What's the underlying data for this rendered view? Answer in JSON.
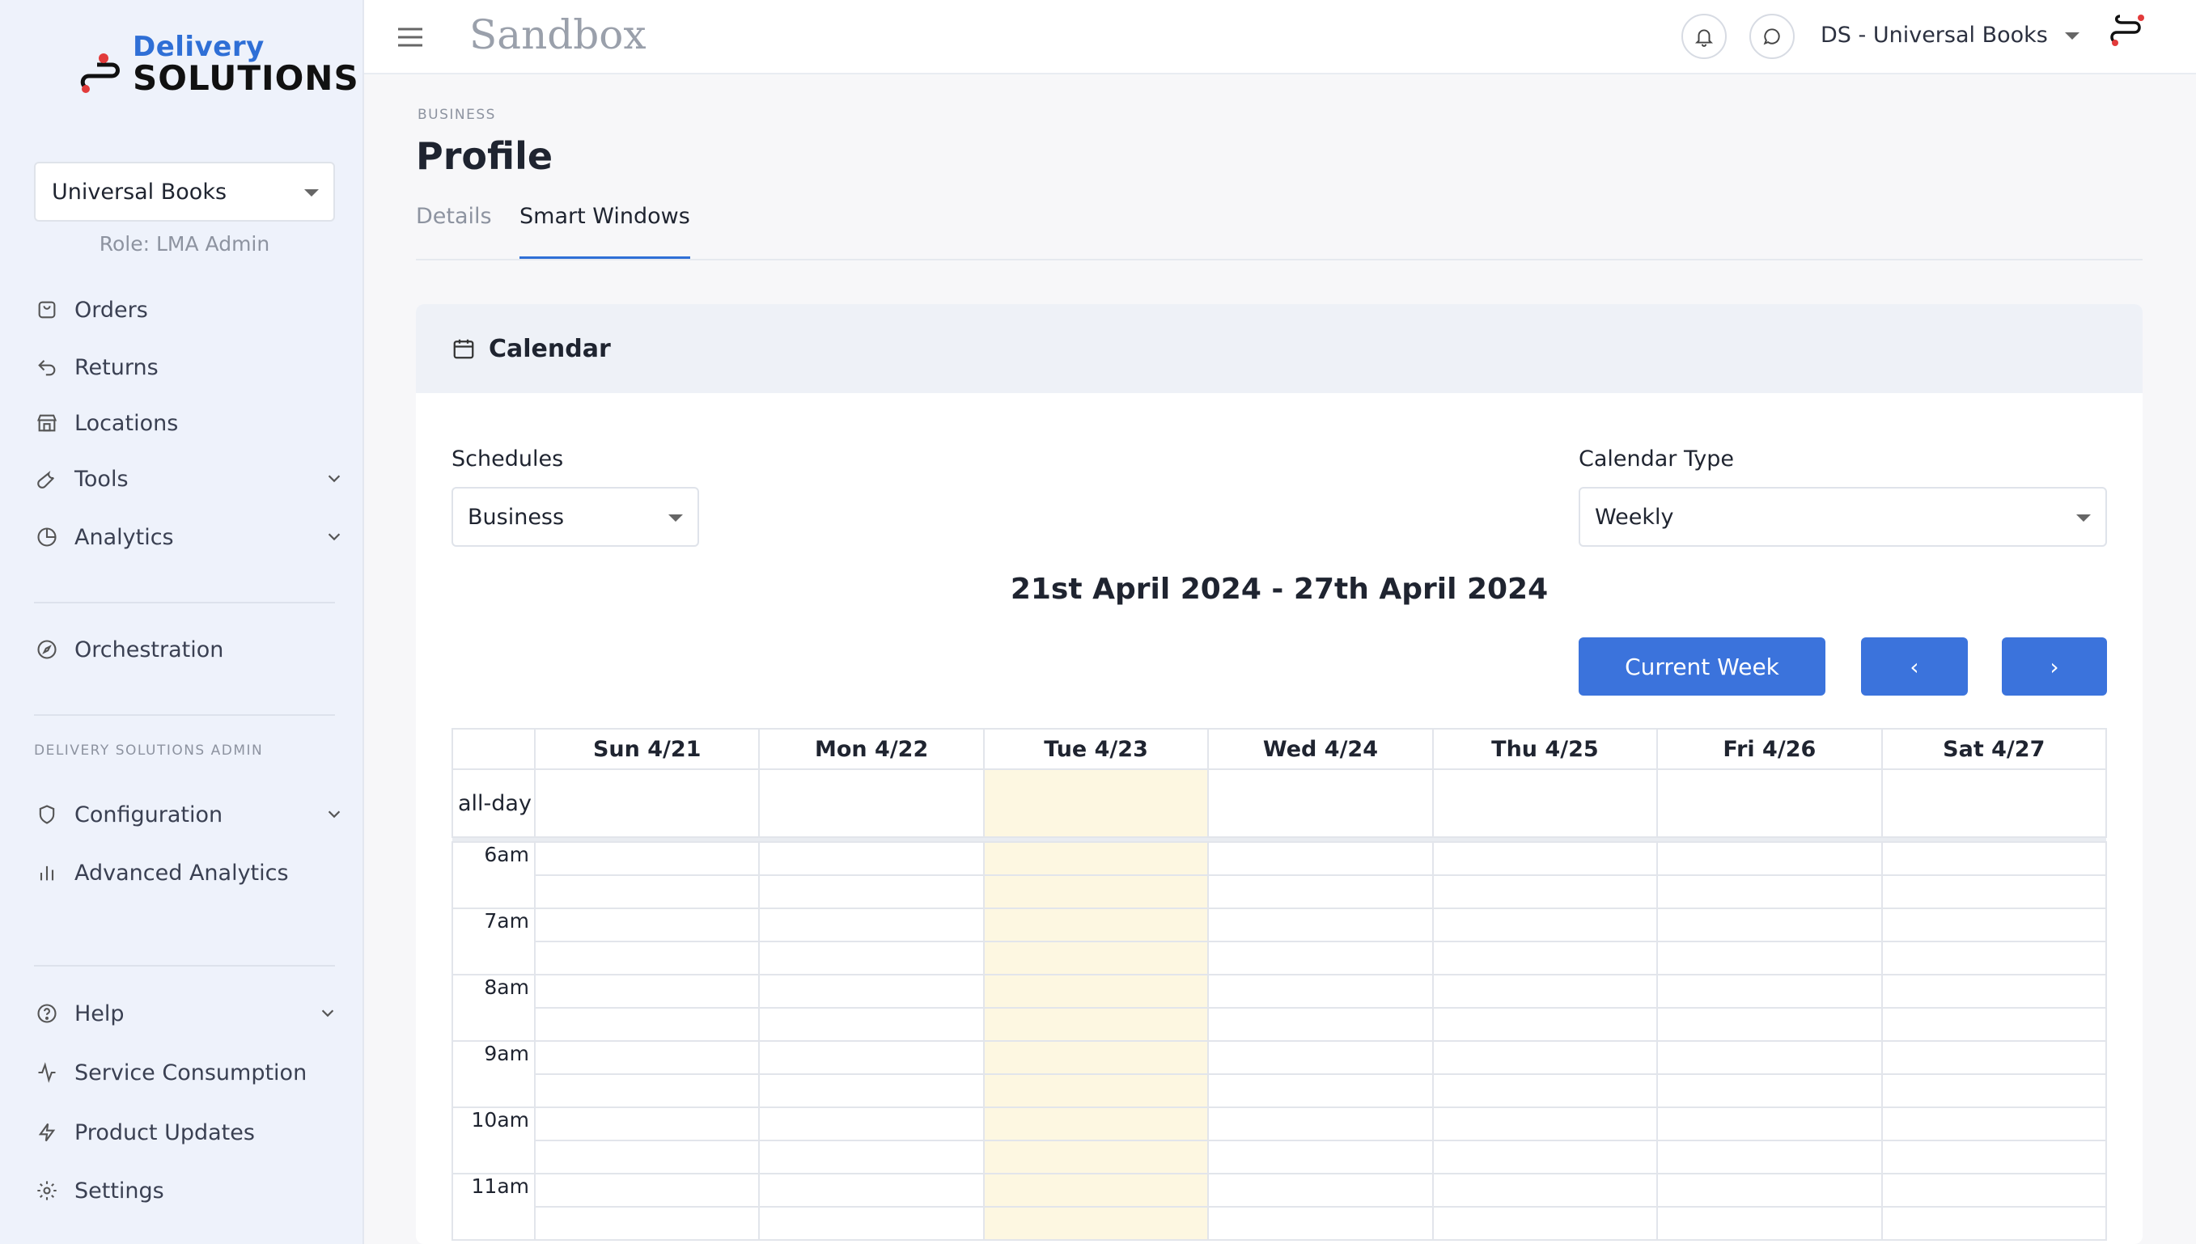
{
  "brand": {
    "line1": "Delivery",
    "line2": "SOLUTIONS"
  },
  "sidebar": {
    "org_selector": "Universal Books",
    "role": "Role: LMA Admin",
    "items": [
      {
        "label": "Orders",
        "icon": "bag-icon"
      },
      {
        "label": "Returns",
        "icon": "return-arrow-icon"
      },
      {
        "label": "Locations",
        "icon": "store-icon"
      },
      {
        "label": "Tools",
        "icon": "wrench-icon"
      },
      {
        "label": "Analytics",
        "icon": "pie-chart-icon"
      },
      {
        "label": "Orchestration",
        "icon": "compass-icon"
      }
    ],
    "admin_section_label": "DELIVERY SOLUTIONS ADMIN",
    "admin_items": [
      {
        "label": "Configuration",
        "icon": "shield-icon"
      },
      {
        "label": "Advanced Analytics",
        "icon": "bar-chart-icon"
      }
    ],
    "footer_items": [
      {
        "label": "Help",
        "icon": "help-circle-icon"
      },
      {
        "label": "Service Consumption",
        "icon": "activity-icon"
      },
      {
        "label": "Product Updates",
        "icon": "lightning-icon"
      },
      {
        "label": "Settings",
        "icon": "gear-icon"
      }
    ]
  },
  "topbar": {
    "environment": "Sandbox",
    "account": "DS - Universal Books"
  },
  "page": {
    "breadcrumb": "BUSINESS",
    "title": "Profile",
    "tabs": [
      "Details",
      "Smart Windows"
    ],
    "active_tab": "Smart Windows"
  },
  "calendar": {
    "card_title": "Calendar",
    "schedules_label": "Schedules",
    "schedules_value": "Business",
    "type_label": "Calendar Type",
    "type_value": "Weekly",
    "range": "21st April 2024 - 27th April 2024",
    "current_week_label": "Current Week",
    "prev_label": "‹",
    "next_label": "›",
    "days": [
      "Sun 4/21",
      "Mon 4/22",
      "Tue 4/23",
      "Wed 4/24",
      "Thu 4/25",
      "Fri 4/26",
      "Sat 4/27"
    ],
    "highlighted_day": "Tue 4/23",
    "all_day_label": "all-day",
    "hours": [
      "6am",
      "7am",
      "8am",
      "9am",
      "10am",
      "11am"
    ]
  },
  "colors": {
    "accent": "#3b73dc",
    "today": "#fdf7e1"
  }
}
